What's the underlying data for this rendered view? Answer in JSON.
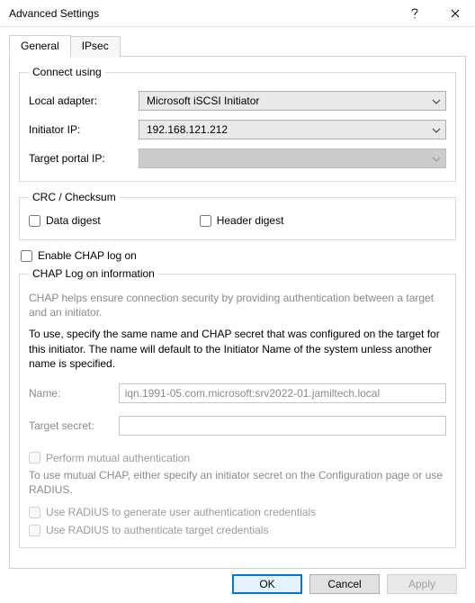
{
  "title": "Advanced Settings",
  "tabs": {
    "general": "General",
    "ipsec": "IPsec"
  },
  "connect": {
    "legend": "Connect using",
    "local_adapter_label": "Local adapter:",
    "local_adapter_value": "Microsoft iSCSI Initiator",
    "initiator_ip_label": "Initiator IP:",
    "initiator_ip_value": "192.168.121.212",
    "target_portal_ip_label": "Target portal IP:",
    "target_portal_ip_value": ""
  },
  "crc": {
    "legend": "CRC / Checksum",
    "data_digest": "Data digest",
    "header_digest": "Header digest"
  },
  "chap": {
    "enable_label": "Enable CHAP log on",
    "legend": "CHAP Log on information",
    "help1": "CHAP helps ensure connection security by providing authentication between a target and an initiator.",
    "help2": "To use, specify the same name and CHAP secret that was configured on the target for this initiator.  The name will default to the Initiator Name of the system unless another name is specified.",
    "name_label": "Name:",
    "name_value": "iqn.1991-05.com.microsoft:srv2022-01.jamiltech.local",
    "secret_label": "Target secret:",
    "secret_value": "",
    "mutual_label": "Perform mutual authentication",
    "mutual_help": "To use mutual CHAP, either specify an initiator secret on the Configuration page or use RADIUS.",
    "radius_gen": "Use RADIUS to generate user authentication credentials",
    "radius_auth": "Use RADIUS to authenticate target credentials"
  },
  "buttons": {
    "ok": "OK",
    "cancel": "Cancel",
    "apply": "Apply"
  }
}
